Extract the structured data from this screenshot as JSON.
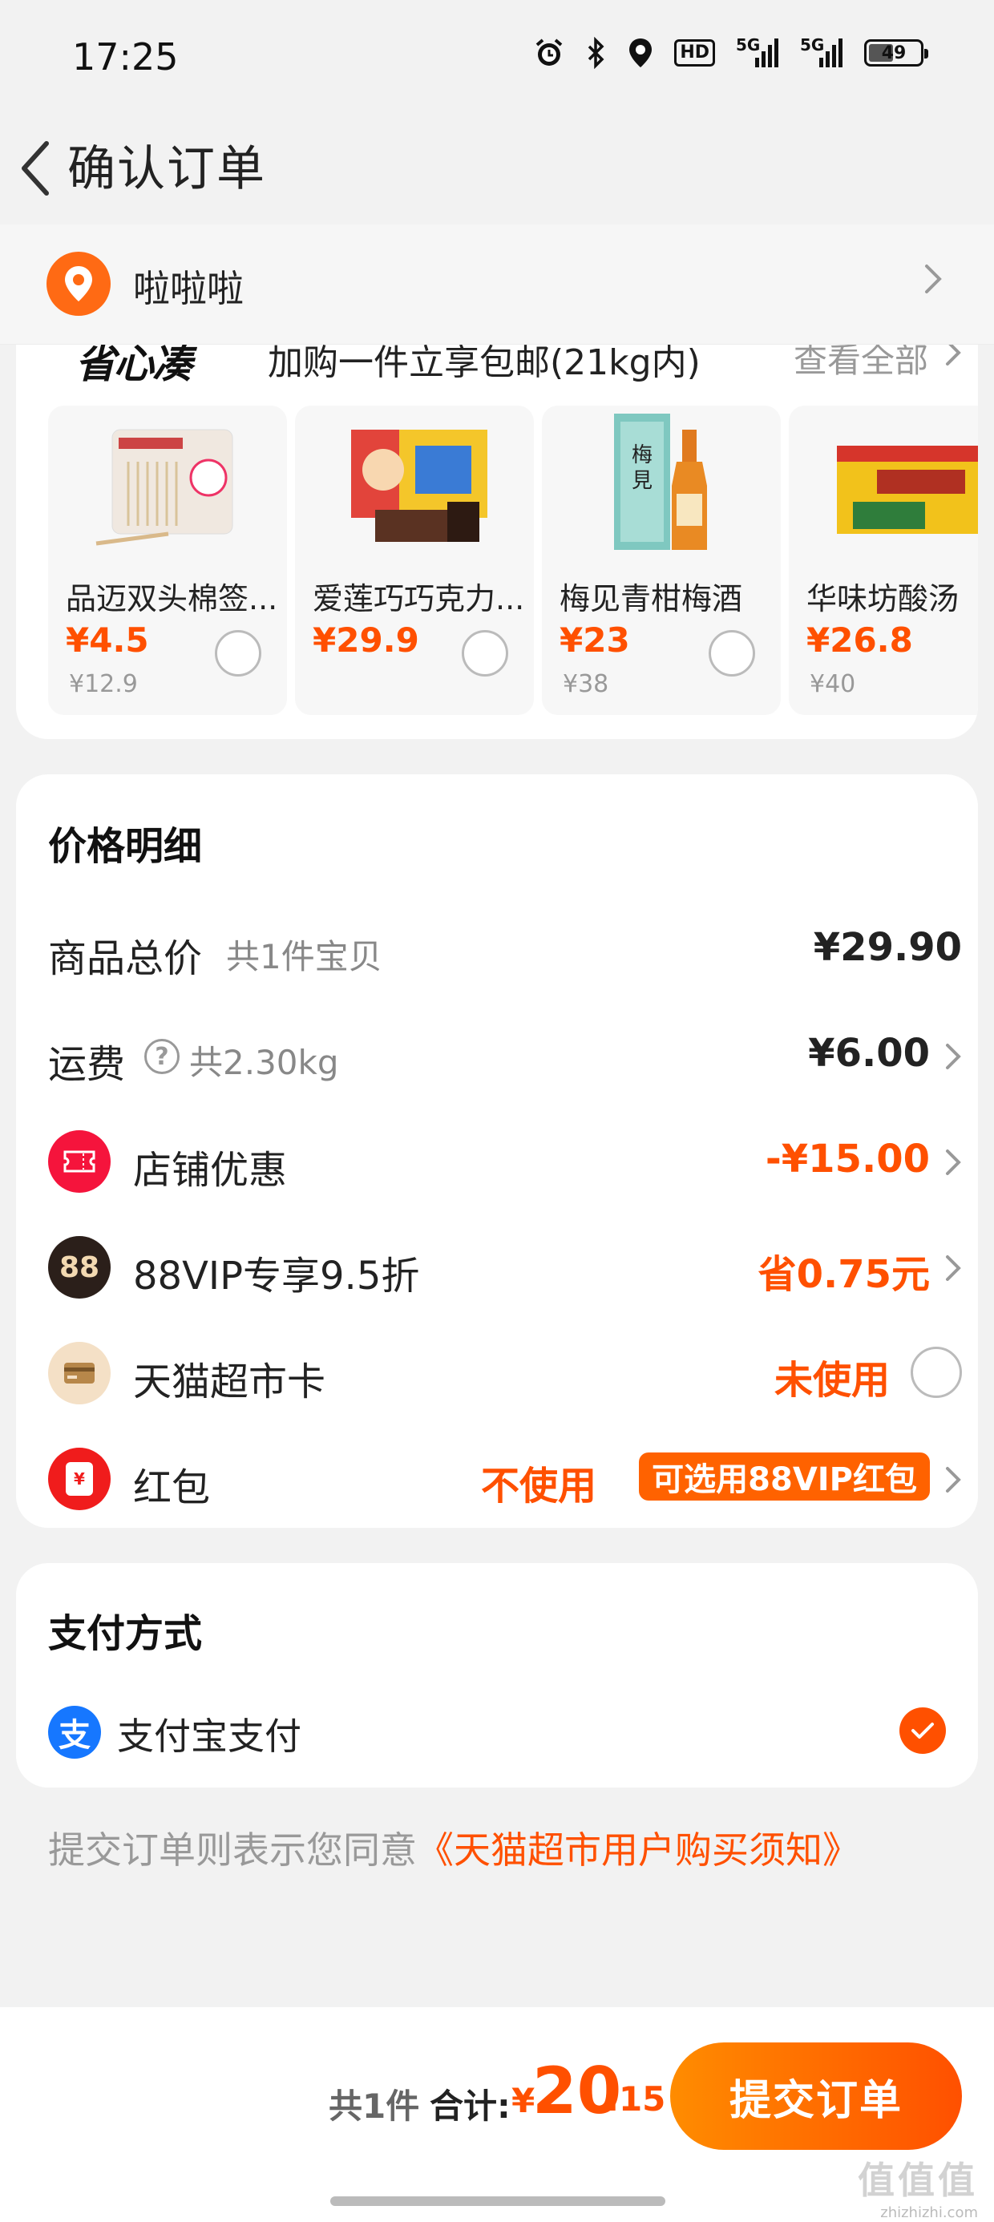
{
  "status_bar": {
    "time": "17:25",
    "icons": [
      "alarm-icon",
      "bluetooth-icon",
      "location-icon",
      "hd-icon",
      "signal-5g-icon",
      "signal-5g-icon",
      "battery-icon"
    ],
    "hd_label": "HD",
    "net1": "5G",
    "net2": "5G",
    "battery": "49",
    "battery_level": 0.49
  },
  "nav": {
    "title": "确认订单"
  },
  "address": {
    "name": "啦啦啦"
  },
  "recommend": {
    "logo": "省心凑",
    "promo": "加购一件立享包邮(21kg内)",
    "view_all": "查看全部",
    "products": [
      {
        "name": "品迈双头棉签...",
        "price": "¥4.5",
        "original": "¥12.9"
      },
      {
        "name": "爱莲巧巧克力...",
        "price": "¥29.9",
        "original": ""
      },
      {
        "name": "梅见青柑梅酒",
        "price": "¥23",
        "original": "¥38"
      },
      {
        "name": "华味坊酸汤",
        "price": "¥26.8",
        "original": "¥40"
      }
    ]
  },
  "price_detail": {
    "title": "价格明细",
    "goods_total_label": "商品总价",
    "goods_count": "共1件宝贝",
    "goods_total_value": "¥29.90",
    "shipping_label": "运费",
    "shipping_weight": "共2.30kg",
    "shipping_value": "¥6.00",
    "store_discount_label": "店铺优惠",
    "store_discount_value": "-¥15.00",
    "vip_label": "88VIP专享9.5折",
    "vip_icon_text": "88",
    "vip_value": "省0.75元",
    "card_label": "天猫超市卡",
    "card_value": "未使用",
    "redpacket_label": "红包",
    "redpacket_icon_text": "¥",
    "redpacket_value": "不使用",
    "redpacket_badge": "可选用88VIP红包"
  },
  "payment": {
    "title": "支付方式",
    "alipay_icon_text": "支",
    "method": "支付宝支付"
  },
  "agreement": {
    "prefix": "提交订单则表示您同意",
    "link": "《天猫超市用户购买须知》"
  },
  "bottom": {
    "count": "共1件",
    "total_label": "合计:",
    "currency": "¥",
    "total_int": "20",
    "total_dec": ".15",
    "submit": "提交订单",
    "watermark": "值值值",
    "watermark_url": "zhizhizhi.com"
  },
  "colors": {
    "accent": "#ff5000",
    "background": "#f2f2f2"
  }
}
